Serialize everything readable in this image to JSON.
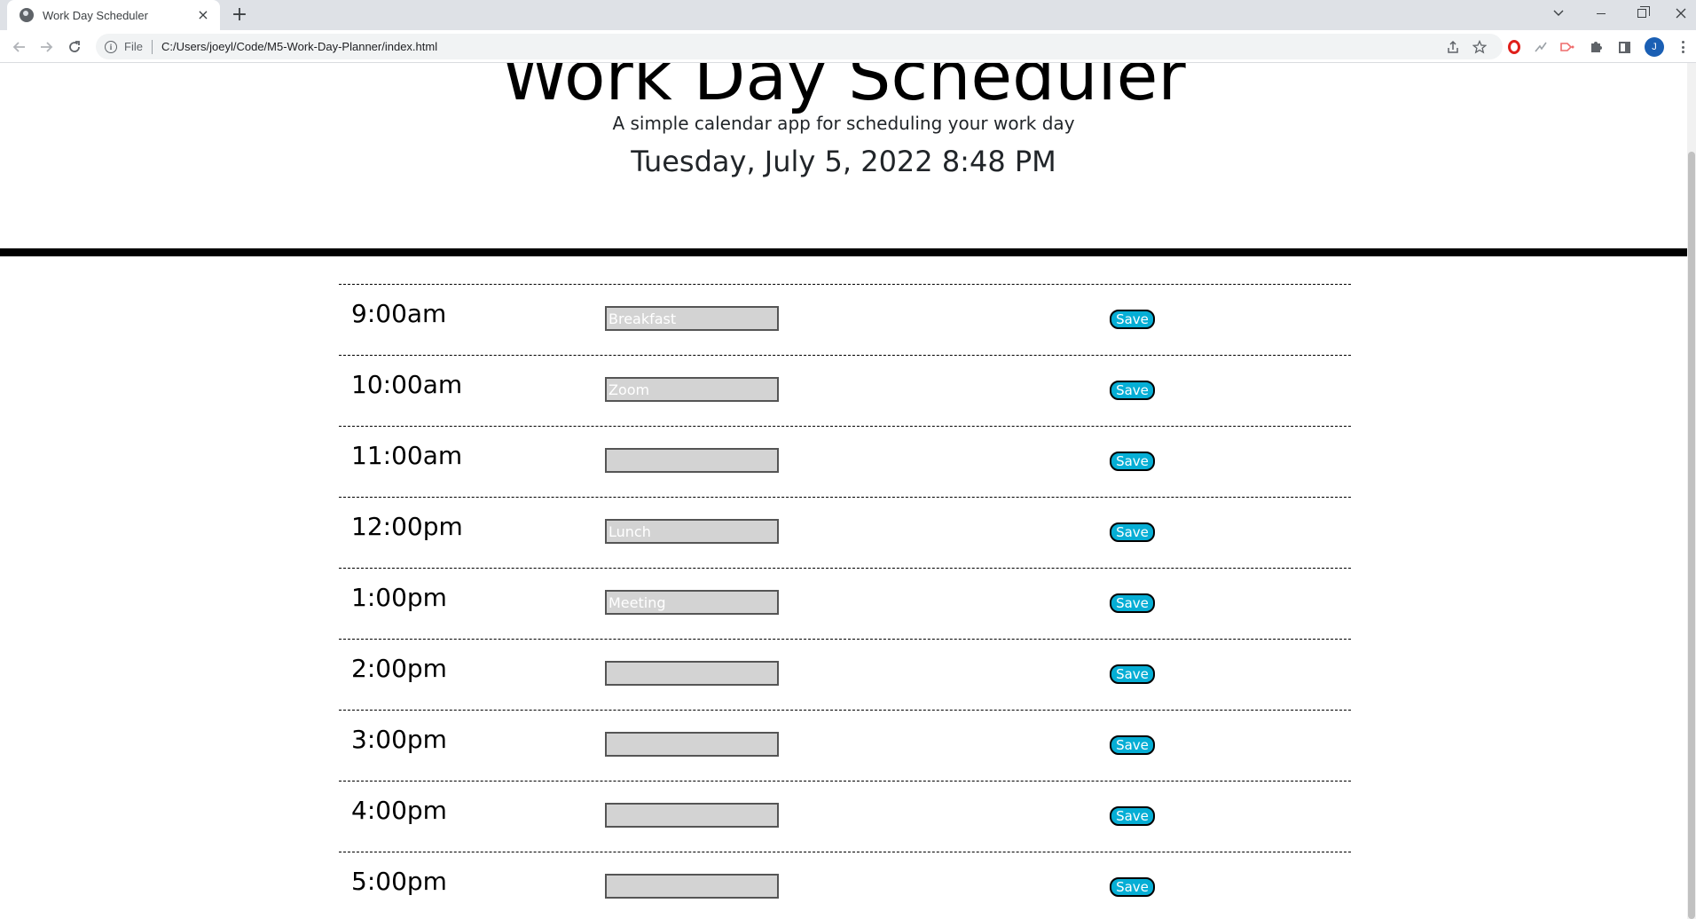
{
  "browser": {
    "tab_title": "Work Day Scheduler",
    "tab_close": "×",
    "new_tab": "+",
    "url_scheme": "File",
    "url": "C:/Users/joeyl/Code/M5-Work-Day-Planner/index.html",
    "avatar_initial": "J",
    "icons": [
      "globe-icon",
      "close-icon",
      "plus-icon",
      "chevron-down-icon",
      "minimize-icon",
      "restore-icon",
      "window-close-icon",
      "back-arrow-icon",
      "forward-arrow-icon",
      "reload-icon",
      "info-icon",
      "share-icon",
      "star-icon",
      "opera-icon",
      "stats-icon",
      "extension-icon",
      "puzzle-icon",
      "side-panel-icon",
      "more-icon"
    ]
  },
  "header": {
    "title": "Work Day Scheduler",
    "lead": "A simple calendar app for scheduling your work day",
    "current_day": "Tuesday, July 5, 2022 8:48 PM"
  },
  "planner": {
    "save_label": "Save",
    "input_background": "#d3d3d3",
    "save_color": "#06aed5",
    "rows": [
      {
        "hour": "9:00am",
        "event": "Breakfast"
      },
      {
        "hour": "10:00am",
        "event": "Zoom"
      },
      {
        "hour": "11:00am",
        "event": ""
      },
      {
        "hour": "12:00pm",
        "event": "Lunch"
      },
      {
        "hour": "1:00pm",
        "event": "Meeting"
      },
      {
        "hour": "2:00pm",
        "event": ""
      },
      {
        "hour": "3:00pm",
        "event": ""
      },
      {
        "hour": "4:00pm",
        "event": ""
      },
      {
        "hour": "5:00pm",
        "event": ""
      }
    ]
  }
}
